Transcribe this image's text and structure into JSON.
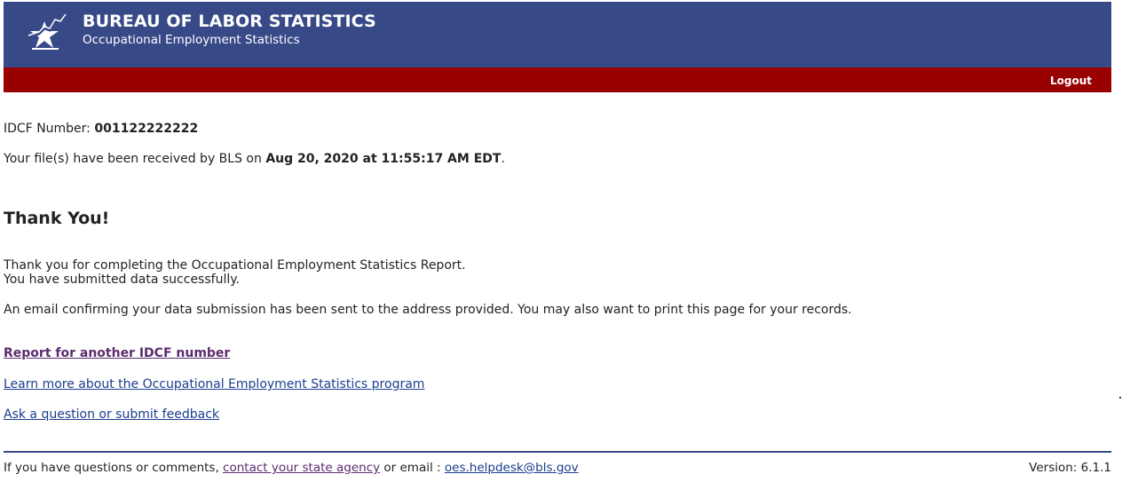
{
  "header": {
    "agency": "BUREAU OF LABOR STATISTICS",
    "program": "Occupational Employment Statistics",
    "logo_icon": "bls-star-logo-icon",
    "bg_color": "#374a87"
  },
  "navbar": {
    "logout_label": "Logout",
    "bg_color": "#990000"
  },
  "confirmation": {
    "idcf_label": "IDCF Number: ",
    "idcf_value": "001122222222",
    "received_prefix": "Your file(s) have been received by BLS on ",
    "received_datetime": "Aug 20, 2020 at 11:55:17 AM EDT",
    "received_suffix": "."
  },
  "thanks": {
    "heading": "Thank You!",
    "line1": "Thank you for completing the Occupational Employment Statistics Report.",
    "line2": "You have submitted data successfully.",
    "email_note": "An email confirming your data submission has been sent to the address provided. You may also want to print this page for your records."
  },
  "links": {
    "another_idcf": "Report for another IDCF number",
    "learn_more": "Learn more about the Occupational Employment Statistics program",
    "ask_question": "Ask a question or submit feedback"
  },
  "footer": {
    "prefix": "If you have questions or comments, ",
    "state_agency_link": "contact your state agency",
    "middle": " or email : ",
    "email_link": "oes.helpdesk@bls.gov",
    "version": "Version: 6.1.1"
  }
}
